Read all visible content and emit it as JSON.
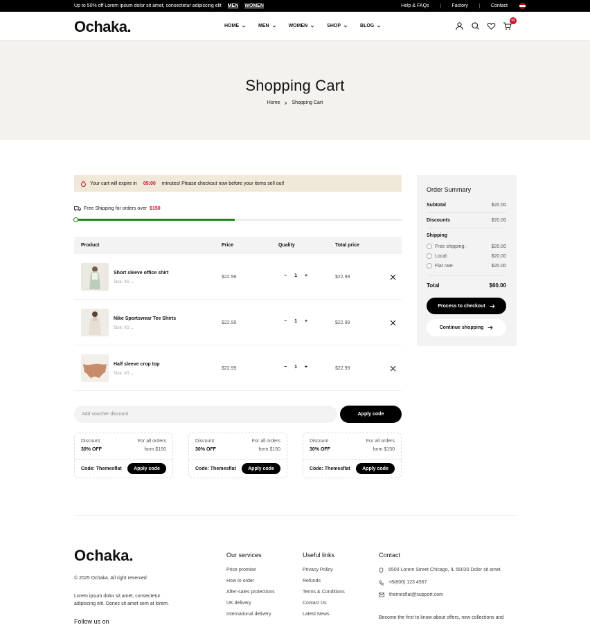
{
  "topbar": {
    "promo": "Up to 50% off Lorem ipsum dolor sit amet, consectetur adipiscing elit",
    "link_men": "MEN",
    "link_women": "WOMEN",
    "links": [
      "Help & FAQs",
      "Factory",
      "Contact"
    ]
  },
  "header": {
    "logo": "Ochaka.",
    "nav": [
      "HOME",
      "MEN",
      "WOMEN",
      "SHOP",
      "BLOG"
    ],
    "cart_count": "99"
  },
  "hero": {
    "title": "Shopping Cart",
    "crumb_home": "Home",
    "crumb_current": "Shopping Cart"
  },
  "timer": {
    "prefix": "Your cart will expire in",
    "time": "05:00",
    "suffix": "minutes! Please checkout now before your items sell out!"
  },
  "shipping_bar": {
    "text": "Free Shipping for orders over",
    "amount": "$150",
    "progress": 0.49
  },
  "table": {
    "headers": [
      "Product",
      "Price",
      "Quality",
      "Total price"
    ],
    "rows": [
      {
        "name": "Short sleeve office shirt",
        "size": "Size: XS",
        "price": "$22.99",
        "qty": "1",
        "total": "$22.99"
      },
      {
        "name": "Nike Sportswear Tee Shirts",
        "size": "Size: XS",
        "price": "$22.99",
        "qty": "1",
        "total": "$22.99"
      },
      {
        "name": "Half sleeve crop top",
        "size": "Size: XS",
        "price": "$22.99",
        "qty": "1",
        "total": "$22.99"
      }
    ]
  },
  "voucher": {
    "placeholder": "Add voucher discount",
    "button": "Apply code"
  },
  "coupons": [
    {
      "label": "Discount",
      "value": "30% OFF",
      "cond1": "For all orders",
      "cond2": "form $150",
      "code": "Code: Themesflat",
      "button": "Apply code"
    },
    {
      "label": "Discount",
      "value": "30% OFF",
      "cond1": "For all orders",
      "cond2": "form $150",
      "code": "Code: Themesflat",
      "button": "Apply code"
    },
    {
      "label": "Discount",
      "value": "30% OFF",
      "cond1": "For all orders",
      "cond2": "form $150",
      "code": "Code: Themesflat",
      "button": "Apply code"
    }
  ],
  "summary": {
    "title": "Order Summary",
    "subtotal_label": "Subtotal",
    "subtotal": "$20.00",
    "discounts_label": "Discounts",
    "discounts": "$20.00",
    "shipping_label": "Shipping",
    "options": [
      {
        "label": "Free shipping:",
        "value": "$20.00"
      },
      {
        "label": "Local:",
        "value": "$20.00"
      },
      {
        "label": "Flat rate:",
        "value": "$20.00"
      }
    ],
    "total_label": "Total",
    "total": "$60.00",
    "checkout": "Process to checkout",
    "continue": "Continue shopping"
  },
  "footer": {
    "logo": "Ochaka.",
    "copyright": "© 2025 Ochaka. All right reserved",
    "desc": "Lorem ipsum dolor sit amet, consectetur adipiscing elit. Donec sit amet sem at lorem.",
    "follow": "Follow us on",
    "services_title": "Our services",
    "services": [
      "Price promise",
      "How to order",
      "After-sales protections",
      "UK delivery",
      "International delivery"
    ],
    "links_title": "Useful links",
    "links": [
      "Privacy Policy",
      "Refunds",
      "Terms & Conditions",
      "Contact Us",
      "Latest News"
    ],
    "contact_title": "Contact",
    "address": "6500 Lorem Street   Chicago, IL 55030 Dolor sit amet",
    "phone": "+8(800) 123 4567",
    "email": "themesflat@support.com",
    "newsletter": "Become the first to know about offers, new collections and"
  },
  "colors": {
    "accent": "#c8102e",
    "progress": "#1a8a1a",
    "hero_bg": "#f3f2ee",
    "timer_bg": "#f0e8d8"
  }
}
